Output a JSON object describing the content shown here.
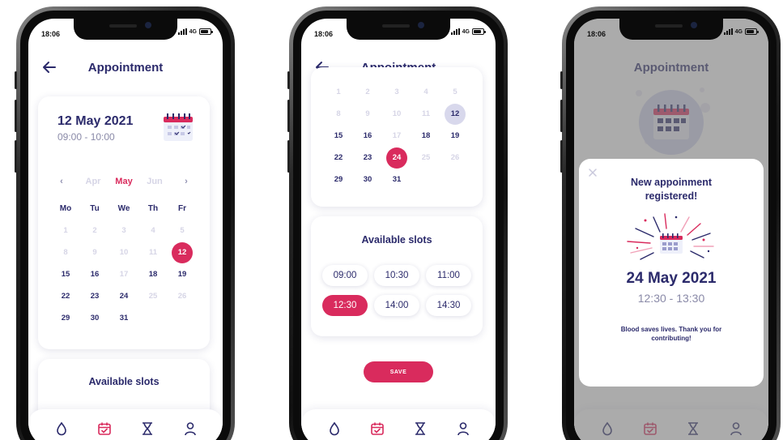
{
  "status": {
    "time": "18:06",
    "network": "4G"
  },
  "header": {
    "title": "Appointment"
  },
  "screen1": {
    "date": "12 May 2021",
    "time": "09:00 - 10:00",
    "months": {
      "prev2": "Apr",
      "current": "May",
      "next": "Jun"
    },
    "weekdays": [
      "Mo",
      "Tu",
      "We",
      "Th",
      "Fr"
    ],
    "rows": [
      [
        "1",
        "2",
        "3",
        "4",
        "5"
      ],
      [
        "8",
        "9",
        "10",
        "11",
        "12"
      ],
      [
        "15",
        "16",
        "17",
        "18",
        "19"
      ],
      [
        "22",
        "23",
        "24",
        "25",
        "26"
      ],
      [
        "29",
        "30",
        "31",
        "",
        ""
      ]
    ],
    "slots_title": "Available slots"
  },
  "screen2": {
    "rows": [
      [
        "1",
        "2",
        "3",
        "4",
        "5"
      ],
      [
        "8",
        "9",
        "10",
        "11",
        "12"
      ],
      [
        "15",
        "16",
        "17",
        "18",
        "19"
      ],
      [
        "22",
        "23",
        "24",
        "25",
        "26"
      ],
      [
        "29",
        "30",
        "31",
        "",
        ""
      ]
    ],
    "slots_title": "Available slots",
    "slots": [
      "09:00",
      "10:30",
      "11:00",
      "12:30",
      "14:00",
      "14:30"
    ],
    "selected_slot": "12:30",
    "save_label": "SAVE"
  },
  "screen3": {
    "modal_title": "New appoinment registered!",
    "date": "24 May 2021",
    "time": "12:30 - 13:30",
    "message": "Blood saves lives. Thank you for contributing!"
  },
  "colors": {
    "accent": "#d92b5d",
    "navy": "#2b2a6b",
    "muted": "#8a8aa8",
    "faded": "#d6d5e6",
    "lavender": "#d8d8ec"
  },
  "icons": [
    "back-arrow-icon",
    "calendar-icon",
    "drop-icon",
    "calendar-check-icon",
    "hourglass-icon",
    "user-icon",
    "close-icon",
    "chevron-left-icon",
    "chevron-right-icon",
    "party-calendar-icon"
  ]
}
